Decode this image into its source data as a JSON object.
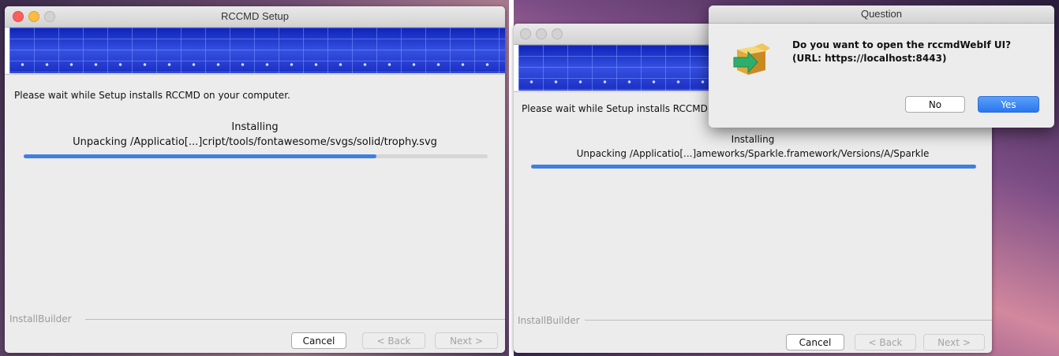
{
  "left_window": {
    "title": "RCCMD Setup",
    "message": "Please wait while Setup installs RCCMD on your computer.",
    "status": "Installing",
    "detail": "Unpacking /Applicatio[...]cript/tools/fontawesome/svgs/solid/trophy.svg",
    "progress": 0.76,
    "footer": "InstallBuilder",
    "buttons": {
      "cancel": "Cancel",
      "back": "< Back",
      "next": "Next >"
    }
  },
  "right_window": {
    "message": "Please wait while Setup installs RCCMD o",
    "status": "Installing",
    "detail": "Unpacking /Applicatio[...]ameworks/Sparkle.framework/Versions/A/Sparkle",
    "progress": 1.0,
    "footer": "InstallBuilder",
    "buttons": {
      "cancel": "Cancel",
      "back": "< Back",
      "next": "Next >"
    }
  },
  "dialog": {
    "title": "Question",
    "line1": "Do you want to open the rccmdWebIf UI?",
    "line2": "(URL: https://localhost:8443)",
    "no": "No",
    "yes": "Yes",
    "icon": "open-arrow-box-icon"
  },
  "colors": {
    "accent": "#2a76ee",
    "progress": "#3f7fe0",
    "banner": "#1e36c8"
  }
}
